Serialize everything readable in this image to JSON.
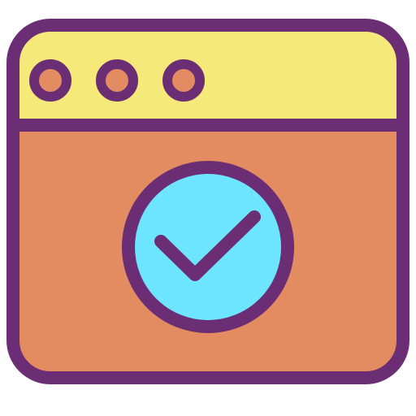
{
  "icon": {
    "name": "browser-window-check-icon",
    "colors": {
      "outline": "#6b2d73",
      "titlebar": "#f5e97a",
      "window_body": "#e38c62",
      "window_button_fill": "#e38c62",
      "check_badge": "#6ee5ff",
      "checkmark": "#6b2d73"
    }
  }
}
